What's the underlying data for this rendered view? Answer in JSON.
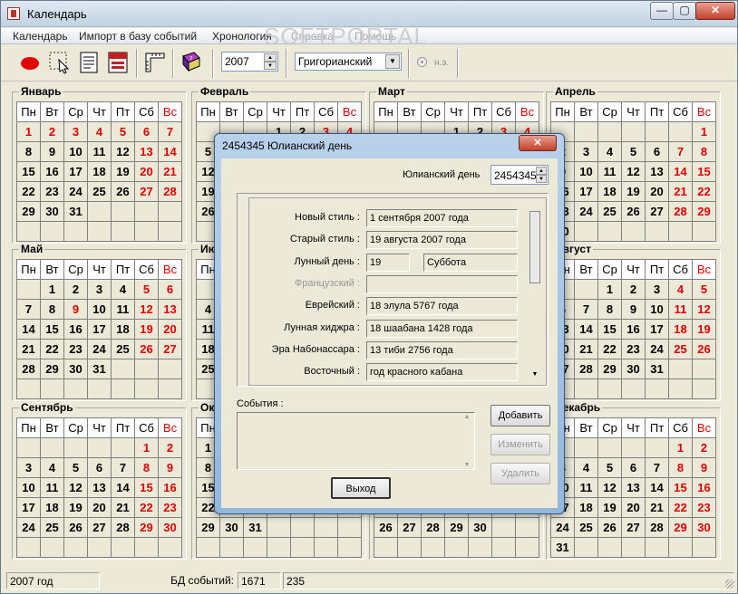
{
  "window": {
    "title": "Календарь",
    "min_label": "—",
    "max_label": "▢",
    "close_label": "✕"
  },
  "menu": [
    "Календарь",
    "Импорт в базу событий",
    "Хронология",
    "Справка",
    "Помощь"
  ],
  "watermark": {
    "text": "SOFTPORTAL",
    "sub": "www.softportal.com"
  },
  "toolbar": {
    "year": "2007",
    "calendar_type": "Григорианский",
    "era_label": "н.э."
  },
  "weekdays": [
    "Пн",
    "Вт",
    "Ср",
    "Чт",
    "Пт",
    "Сб",
    "Вс"
  ],
  "months": [
    {
      "name": "Январь",
      "start": 0,
      "days": 31
    },
    {
      "name": "Февраль",
      "start": 3,
      "days": 28
    },
    {
      "name": "Март",
      "start": 3,
      "days": 31
    },
    {
      "name": "Апрель",
      "start": 6,
      "days": 30
    },
    {
      "name": "Май",
      "start": 1,
      "days": 31
    },
    {
      "name": "Июнь",
      "start": 4,
      "days": 30
    },
    {
      "name": "Июль",
      "start": 6,
      "days": 31
    },
    {
      "name": "Август",
      "start": 2,
      "days": 31
    },
    {
      "name": "Сентябрь",
      "start": 5,
      "days": 30
    },
    {
      "name": "Октябрь",
      "start": 0,
      "days": 31
    },
    {
      "name": "Ноябрь",
      "start": 3,
      "days": 30
    },
    {
      "name": "Декабрь",
      "start": 5,
      "days": 31
    }
  ],
  "status": {
    "year": "2007 год",
    "db_label": "БД событий:",
    "db_count": "1671",
    "other": "235"
  },
  "dialog": {
    "title": "2454345 Юлианский день",
    "julian_label": "Юлианский день",
    "julian_value": "2454345",
    "rows": [
      {
        "label": "Новый стиль :",
        "value": "1 сентября 2007 года"
      },
      {
        "label": "Старый стиль :",
        "value": "19 августа 2007 года"
      },
      {
        "label": "Лунный день :",
        "value": "19",
        "extra": "Суббота"
      },
      {
        "label": "Французский :",
        "value": "",
        "disabled": true
      },
      {
        "label": "Еврейский :",
        "value": "18 элула 5767 года"
      },
      {
        "label": "Лунная хиджра :",
        "value": "18 шаабана 1428 года"
      },
      {
        "label": "Эра Набонассара :",
        "value": "13 тиби 2756 года"
      },
      {
        "label": "Восточный :",
        "value": "год красного кабана"
      }
    ],
    "events_label": "События :",
    "add_label": "Добавить",
    "edit_label": "Изменить",
    "delete_label": "Удалить",
    "exit_label": "Выход"
  }
}
